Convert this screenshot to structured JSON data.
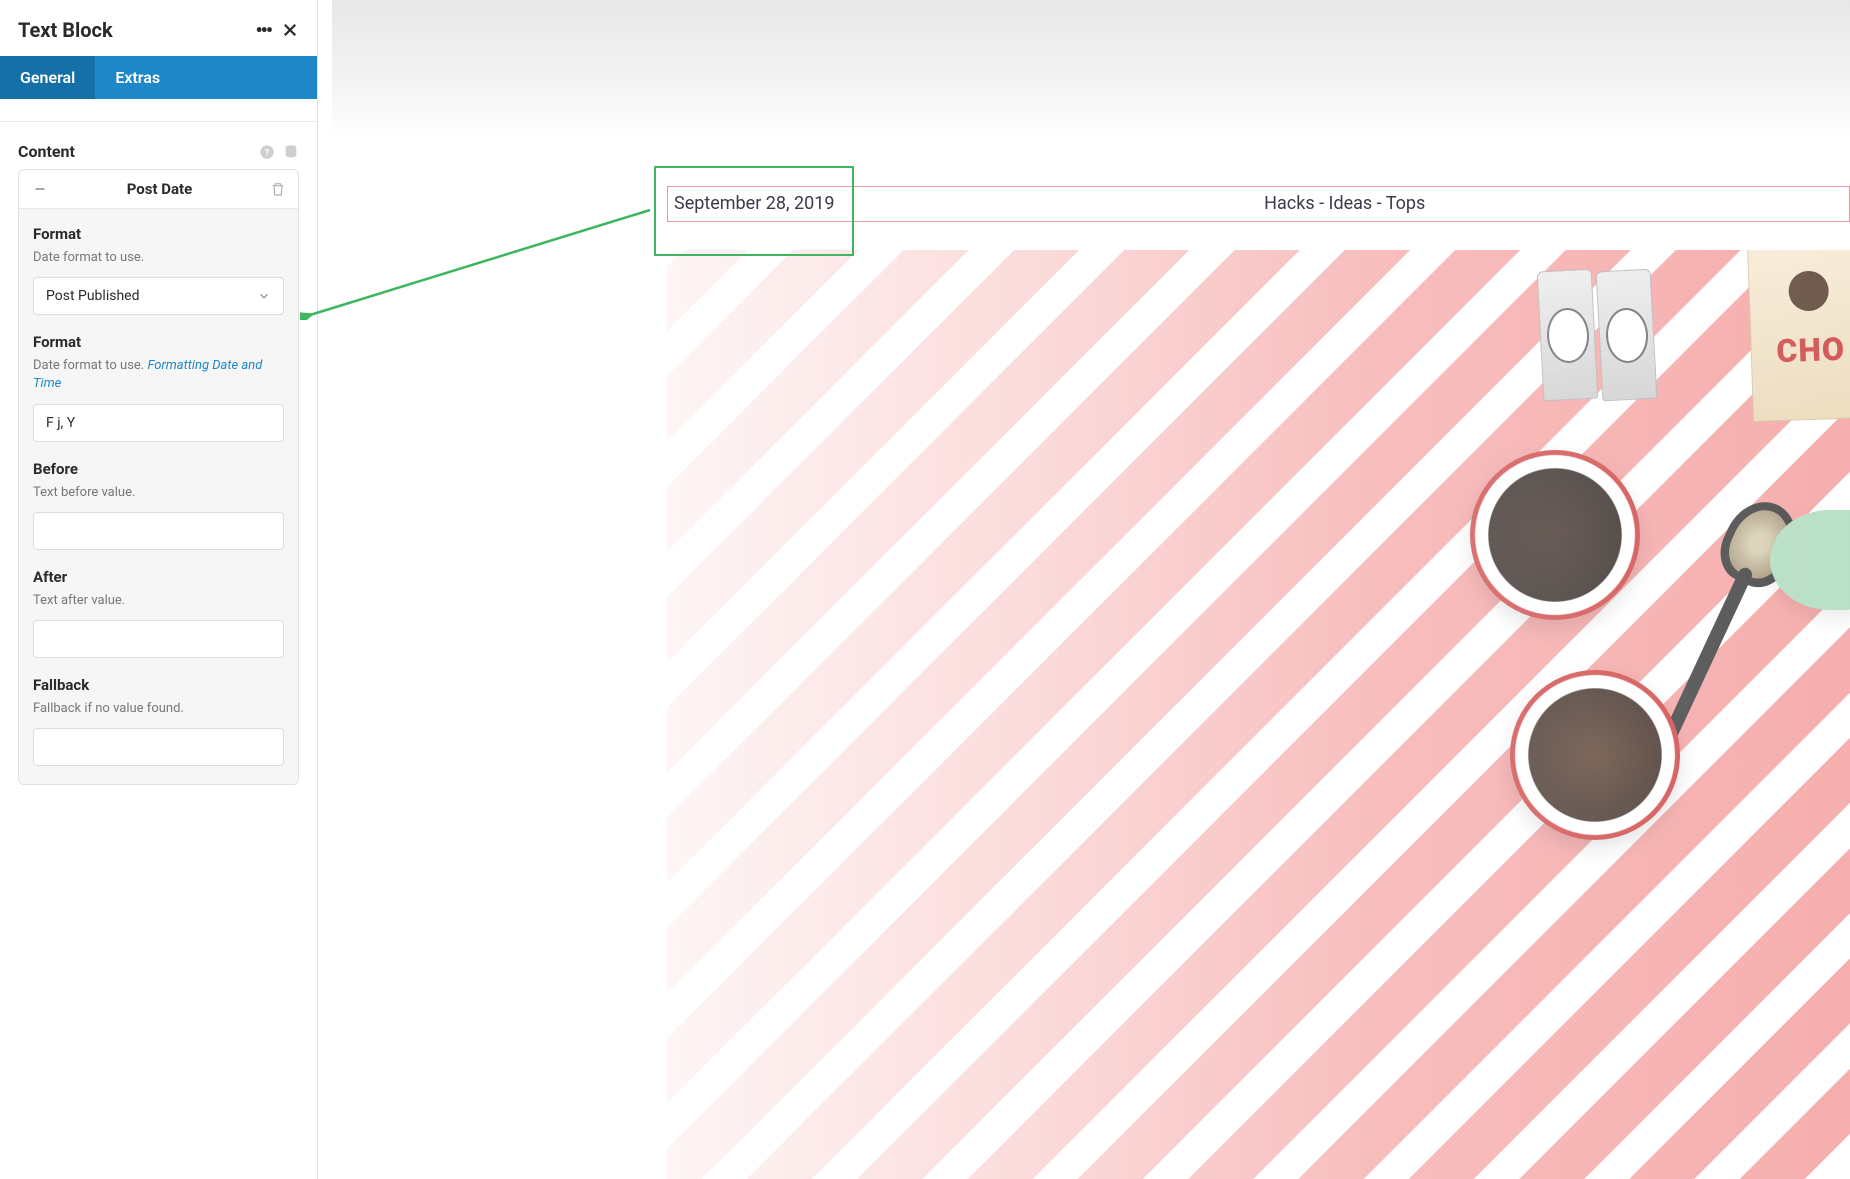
{
  "sidebar": {
    "title": "Text Block",
    "tabs": {
      "general": "General",
      "extras": "Extras"
    },
    "section": {
      "title": "Content"
    },
    "card": {
      "title": "Post Date",
      "fields": {
        "format1": {
          "label": "Format",
          "desc": "Date format to use.",
          "value": "Post Published"
        },
        "format2": {
          "label": "Format",
          "desc_prefix": "Date format to use. ",
          "desc_link": "Formatting Date and Time",
          "value": "F j, Y"
        },
        "before": {
          "label": "Before",
          "desc": "Text before value.",
          "value": ""
        },
        "after": {
          "label": "After",
          "desc": "Text after value.",
          "value": ""
        },
        "fallback": {
          "label": "Fallback",
          "desc": "Fallback if no value found.",
          "value": ""
        }
      }
    }
  },
  "preview": {
    "post_date": "September 28, 2019",
    "post_categories": "Hacks - Ideas - Tops",
    "choc_text": "CHO"
  }
}
